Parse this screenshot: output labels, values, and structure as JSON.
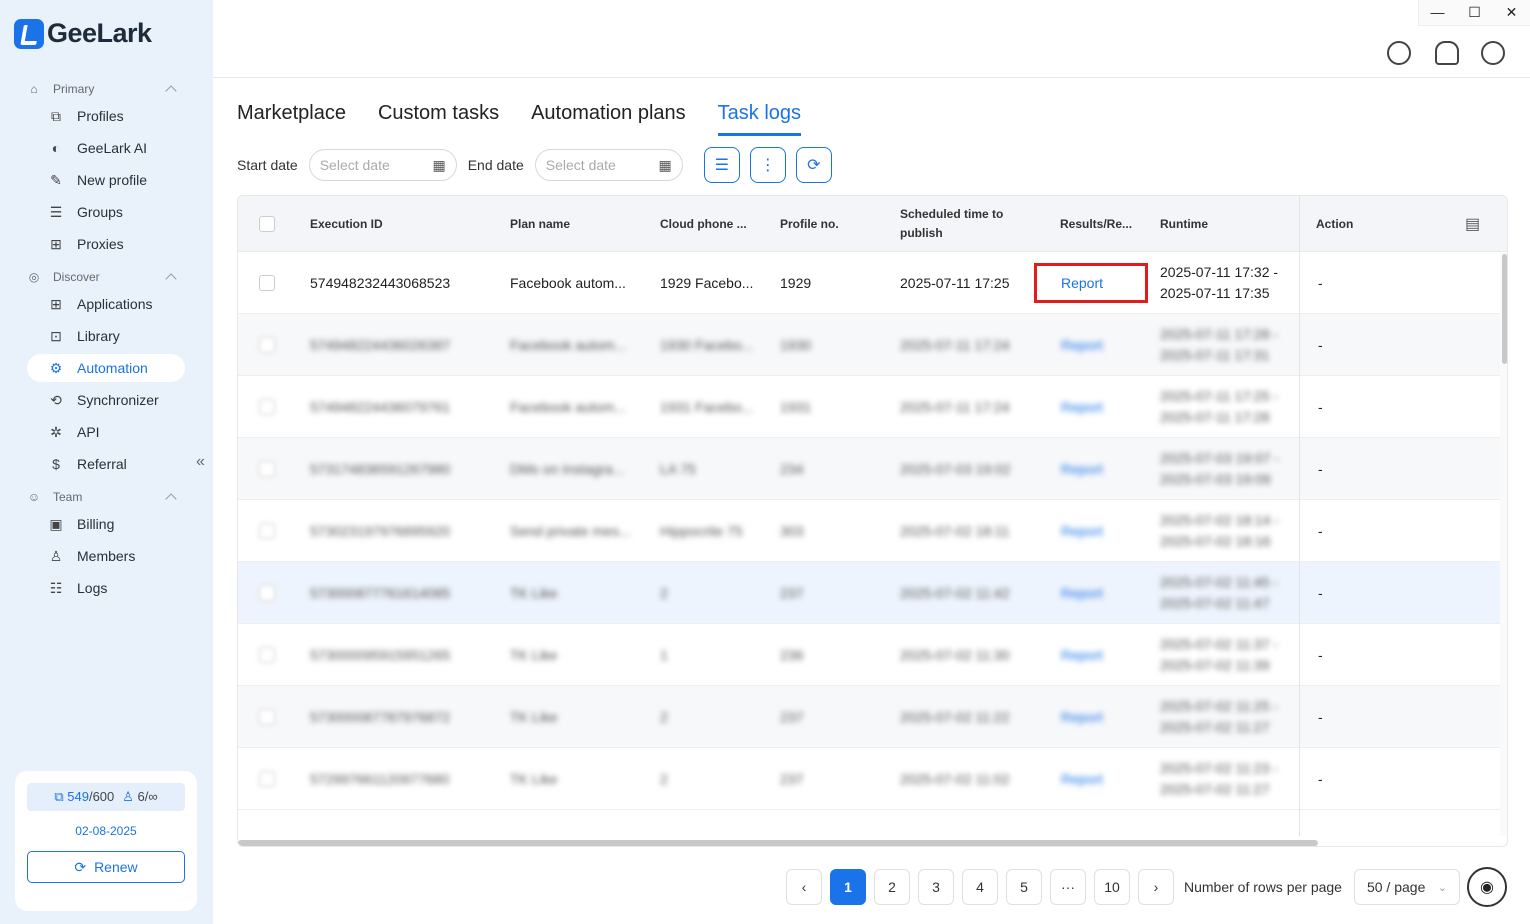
{
  "app": {
    "name": "GeeLark"
  },
  "sidebar": {
    "groups": [
      {
        "label": "Primary"
      },
      {
        "label": "Discover"
      },
      {
        "label": "Team"
      }
    ],
    "items": [
      {
        "label": "Profiles"
      },
      {
        "label": "GeeLark AI"
      },
      {
        "label": "New profile"
      },
      {
        "label": "Groups"
      },
      {
        "label": "Proxies"
      },
      {
        "label": "Applications"
      },
      {
        "label": "Library"
      },
      {
        "label": "Automation"
      },
      {
        "label": "Synchronizer"
      },
      {
        "label": "API"
      },
      {
        "label": "Referral"
      },
      {
        "label": "Billing"
      },
      {
        "label": "Members"
      },
      {
        "label": "Logs"
      }
    ],
    "active": "Automation",
    "quota": {
      "profiles": "549",
      "profiles_max": "/600",
      "members": "6/∞"
    },
    "expiry": "02-08-2025",
    "renew_label": "Renew"
  },
  "window_controls": {
    "min": "—",
    "max": "☐",
    "close": "✕"
  },
  "tabs": [
    {
      "label": "Marketplace"
    },
    {
      "label": "Custom tasks"
    },
    {
      "label": "Automation plans"
    },
    {
      "label": "Task logs"
    }
  ],
  "active_tab": "Task logs",
  "filters": {
    "start_label": "Start date",
    "end_label": "End date",
    "placeholder": "Select date"
  },
  "table": {
    "headers": {
      "execution_id": "Execution ID",
      "plan_name": "Plan name",
      "cloud_phone": "Cloud phone ...",
      "profile_no": "Profile no.",
      "scheduled_1": "Scheduled time to",
      "scheduled_2": "publish",
      "results": "Results/Re...",
      "runtime": "Runtime",
      "action": "Action"
    },
    "rows": [
      {
        "id": "574948232443068523",
        "plan": "Facebook autom...",
        "phone": "1929 Facebo...",
        "profile": "1929",
        "scheduled": "2025-07-11 17:25",
        "result": "Report",
        "runtime_start": "2025-07-11 17:32 -",
        "runtime_end": "2025-07-11 17:35",
        "action": "-"
      },
      {
        "id": "574948224436026387",
        "plan": "Facebook autom...",
        "phone": "1930 Facebo...",
        "profile": "1930",
        "scheduled": "2025-07-11 17:24",
        "result": "Report",
        "runtime_start": "2025-07-11 17:28 -",
        "runtime_end": "2025-07-11 17:31",
        "action": "-"
      },
      {
        "id": "574948224436079761",
        "plan": "Facebook autom...",
        "phone": "1931 Facebo...",
        "profile": "1931",
        "scheduled": "2025-07-11 17:24",
        "result": "Report",
        "runtime_start": "2025-07-11 17:25 -",
        "runtime_end": "2025-07-11 17:28",
        "action": "-"
      },
      {
        "id": "573174836591267980",
        "plan": "DMs on Instagra...",
        "phone": "LA 75",
        "profile": "234",
        "scheduled": "2025-07-03 19:02",
        "result": "Report",
        "runtime_start": "2025-07-03 19:07 -",
        "runtime_end": "2025-07-03 19:09",
        "action": "-"
      },
      {
        "id": "573023197976895920",
        "plan": "Send private mes...",
        "phone": "Hippocrite 75",
        "profile": "303",
        "scheduled": "2025-07-02 18:11",
        "result": "Report",
        "runtime_start": "2025-07-02 18:14 -",
        "runtime_end": "2025-07-02 18:16",
        "action": "-"
      },
      {
        "id": "573000877761614085",
        "plan": "TK Like",
        "phone": "2",
        "profile": "237",
        "scheduled": "2025-07-02 11:42",
        "result": "Report",
        "runtime_start": "2025-07-02 11:45 -",
        "runtime_end": "2025-07-02 11:47",
        "action": "-"
      },
      {
        "id": "573000095915951265",
        "plan": "TK Like",
        "phone": "1",
        "profile": "236",
        "scheduled": "2025-07-02 11:30",
        "result": "Report",
        "runtime_start": "2025-07-02 11:37 -",
        "runtime_end": "2025-07-02 11:39",
        "action": "-"
      },
      {
        "id": "573000087787976872",
        "plan": "TK Like",
        "phone": "2",
        "profile": "237",
        "scheduled": "2025-07-02 11:22",
        "result": "Report",
        "runtime_start": "2025-07-02 11:25 -",
        "runtime_end": "2025-07-02 11:27",
        "action": "-"
      },
      {
        "id": "572997661120977680",
        "plan": "TK Like",
        "phone": "2",
        "profile": "237",
        "scheduled": "2025-07-02 11:02",
        "result": "Report",
        "runtime_start": "2025-07-02 11:23 -",
        "runtime_end": "2025-07-02 11:27",
        "action": "-"
      }
    ]
  },
  "pagination": {
    "prev": "‹",
    "pages": [
      "1",
      "2",
      "3",
      "4",
      "5",
      "···",
      "10"
    ],
    "current": "1",
    "next": "›",
    "rows_label": "Number of rows per page",
    "size": "50 / page"
  },
  "colors": {
    "accent": "#1a73e8",
    "highlight": "#e31b1b",
    "sidebar_bg": "#e9f1fb"
  }
}
